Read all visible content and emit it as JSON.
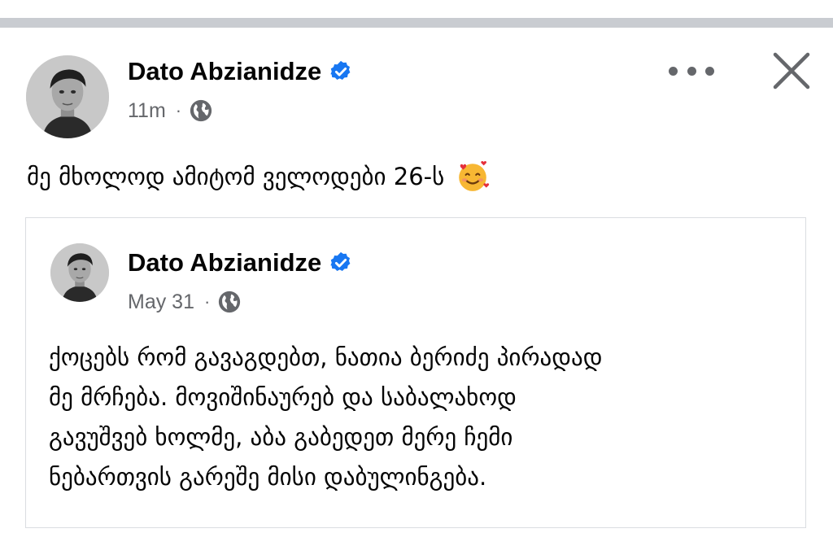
{
  "post": {
    "author": "Dato Abzianidze",
    "time": "11m",
    "separator": "·",
    "text": "მე მხოლოდ ამიტომ ველოდები 26-ს",
    "emoji": "smiling-face-with-hearts"
  },
  "shared_post": {
    "author": "Dato Abzianidze",
    "time": "May 31",
    "separator": "·",
    "lines": [
      "ქოცებს რომ გავაგდებთ, ნათია ბერიძე პირადად",
      "მე მრჩება. მოვიშინაურებ და საბალახოდ",
      "გავუშვებ ხოლმე, აბა გაბედეთ მერე ჩემი",
      "ნებართვის გარეშე მისი დაბულინგება."
    ]
  },
  "icons": {
    "verified": "verified-badge-icon",
    "audience": "globe-icon",
    "more": "more-options-icon",
    "close": "close-icon"
  },
  "colors": {
    "verified_blue": "#1877f2",
    "secondary_text": "#65676b",
    "divider": "#c9ccd1"
  }
}
